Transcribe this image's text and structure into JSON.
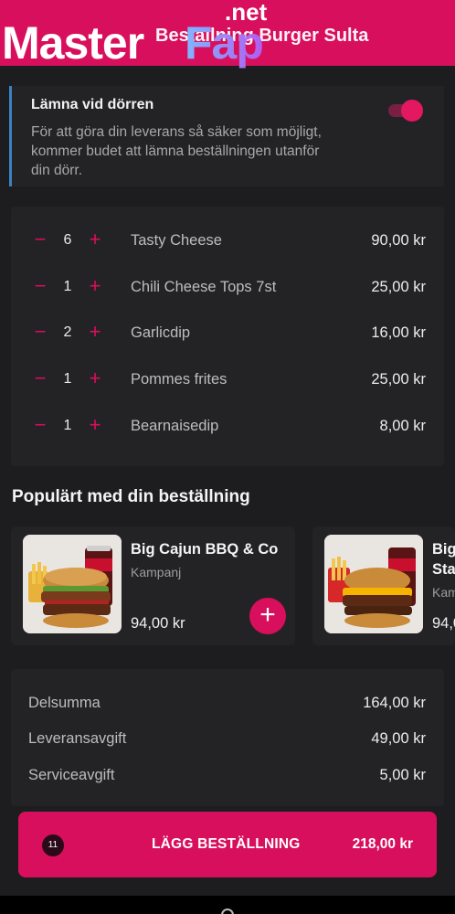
{
  "header": {
    "title": "Beställning Burger Sulta",
    "watermark": {
      "part1": "Master",
      "part2": "Fap",
      "part3": ".net"
    }
  },
  "delivery_option": {
    "title": "Lämna vid dörren",
    "description": "För att göra din leverans så säker som möjligt, kommer budet att lämna beställningen utanför din dörr.",
    "enabled": true
  },
  "order_items": [
    {
      "qty": "6",
      "name": "Tasty Cheese",
      "price": "90,00 kr"
    },
    {
      "qty": "1",
      "name": "Chili Cheese Tops 7st",
      "price": "25,00 kr"
    },
    {
      "qty": "2",
      "name": "Garlicdip",
      "price": "16,00 kr"
    },
    {
      "qty": "1",
      "name": "Pommes frites",
      "price": "25,00 kr"
    },
    {
      "qty": "1",
      "name": "Bearnaisedip",
      "price": "8,00 kr"
    }
  ],
  "controls": {
    "minus": "−",
    "plus": "+"
  },
  "popular": {
    "title": "Populärt med din beställning",
    "products": [
      {
        "name": "Big Cajun BBQ & Co",
        "tag": "Kampanj",
        "price": "94,00 kr",
        "add": "+"
      },
      {
        "name": "Big",
        "name2": "Sta",
        "tag": "Kam",
        "price": "94,0"
      }
    ]
  },
  "summary": {
    "rows": [
      {
        "label": "Delsumma",
        "value": "164,00 kr"
      },
      {
        "label": "Leveransavgift",
        "value": "49,00 kr"
      },
      {
        "label": "Serviceavgift",
        "value": "5,00 kr"
      }
    ]
  },
  "order_button": {
    "count": "11",
    "label": "LÄGG BESTÄLLNING",
    "total": "218,00 kr"
  },
  "colors": {
    "accent": "#d80f5d",
    "background": "#1d1d1f",
    "card": "#232326",
    "info_border": "#3b82c4"
  },
  "icons": [
    "minus-icon",
    "plus-icon",
    "toggle-switch",
    "home-indicator"
  ]
}
